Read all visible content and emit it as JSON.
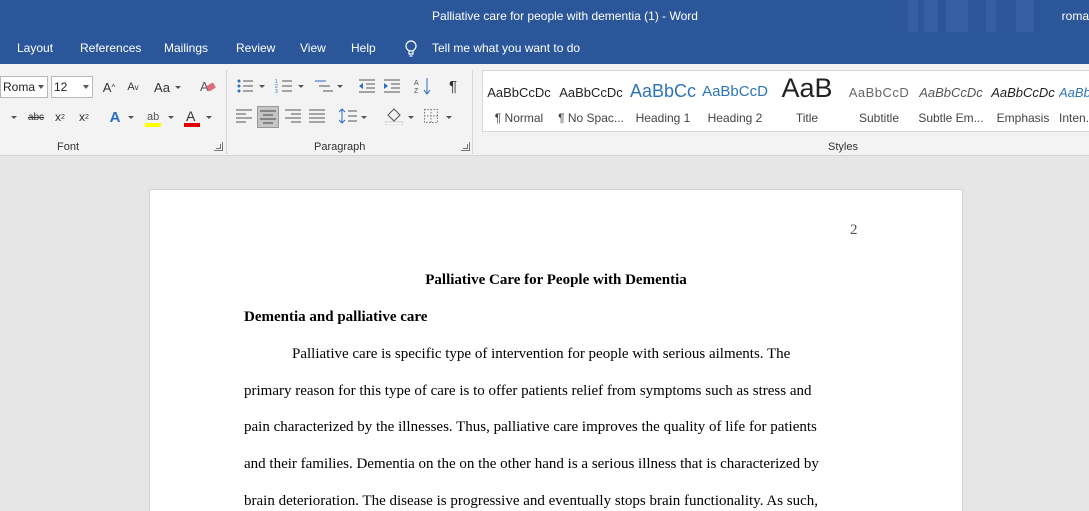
{
  "window": {
    "title": "Palliative care for people with dementia (1)  -  Word",
    "user": "roma"
  },
  "tabs": [
    "Layout",
    "References",
    "Mailings",
    "Review",
    "View",
    "Help"
  ],
  "tell_me": "Tell me what you want to do",
  "ribbon": {
    "font": {
      "name": "Roma",
      "size": "12",
      "grow_label": "A",
      "shrink_label": "A",
      "case_label": "Aa",
      "strike_label": "abc",
      "sub_label": "x",
      "super_label": "x",
      "text_effects_label": "A",
      "font_color_label": "A",
      "group_label": "Font",
      "highlight_color": "#ffff00",
      "font_color": "#e00000"
    },
    "paragraph": {
      "group_label": "Paragraph",
      "show_marks_label": "¶"
    },
    "styles": {
      "group_label": "Styles",
      "items": [
        {
          "preview": "AaBbCcDc",
          "name": "¶ Normal"
        },
        {
          "preview": "AaBbCcDc",
          "name": "¶ No Spac..."
        },
        {
          "preview": "AaBbCc",
          "name": "Heading 1"
        },
        {
          "preview": "AaBbCcD",
          "name": "Heading 2"
        },
        {
          "preview": "AaB",
          "name": "Title"
        },
        {
          "preview": "AaBbCcD",
          "name": "Subtitle"
        },
        {
          "preview": "AaBbCcDc",
          "name": "Subtle Em..."
        },
        {
          "preview": "AaBbCcDc",
          "name": "Emphasis"
        },
        {
          "preview": "AaBbCcDc",
          "name": "Inten..."
        }
      ]
    }
  },
  "document": {
    "page_number": "2",
    "title": "Palliative Care for People with Dementia",
    "heading": "Dementia and palliative care",
    "lines": [
      "Palliative care is specific type of intervention for people with serious ailments. The",
      "primary reason for this type of care is to offer patients relief from symptoms such as stress and",
      "pain characterized by the illnesses. Thus, palliative care improves the quality of life for patients",
      "and their families. Dementia on the on the other hand is a serious illness that is characterized by",
      "brain deterioration. The disease is progressive and eventually stops brain functionality. As such,"
    ]
  }
}
